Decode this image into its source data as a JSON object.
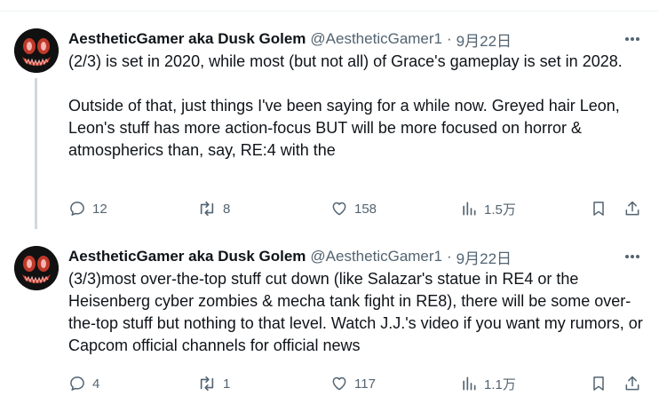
{
  "tweets": [
    {
      "author": {
        "name": "AestheticGamer aka Dusk Golem",
        "handle": "@AestheticGamer1"
      },
      "date": "9月22日",
      "separator": "·",
      "text": "(2/3) is set in 2020, while most (but not all) of Grace's gameplay is set in 2028.\n\nOutside of that, just things I've been saying for a while now. Greyed hair Leon, Leon's stuff has more action-focus BUT will be more focused on horror & atmospherics than, say, RE:4 with the",
      "stats": {
        "replies": "12",
        "reposts": "8",
        "likes": "158",
        "views": "1.5万"
      }
    },
    {
      "author": {
        "name": "AestheticGamer aka Dusk Golem",
        "handle": "@AestheticGamer1"
      },
      "date": "9月22日",
      "separator": "·",
      "text": "(3/3)most over-the-top stuff cut down (like Salazar's statue in RE4 or the Heisenberg cyber zombies & mecha tank fight in RE8), there will be some over-the-top stuff but nothing to that level. Watch J.J.'s video if you want my rumors, or Capcom official channels for official news",
      "stats": {
        "replies": "4",
        "reposts": "1",
        "likes": "117",
        "views": "1.1万"
      }
    }
  ],
  "icons": [
    "more-icon",
    "reply-icon",
    "repost-icon",
    "like-icon",
    "views-icon",
    "bookmark-icon",
    "share-icon"
  ]
}
